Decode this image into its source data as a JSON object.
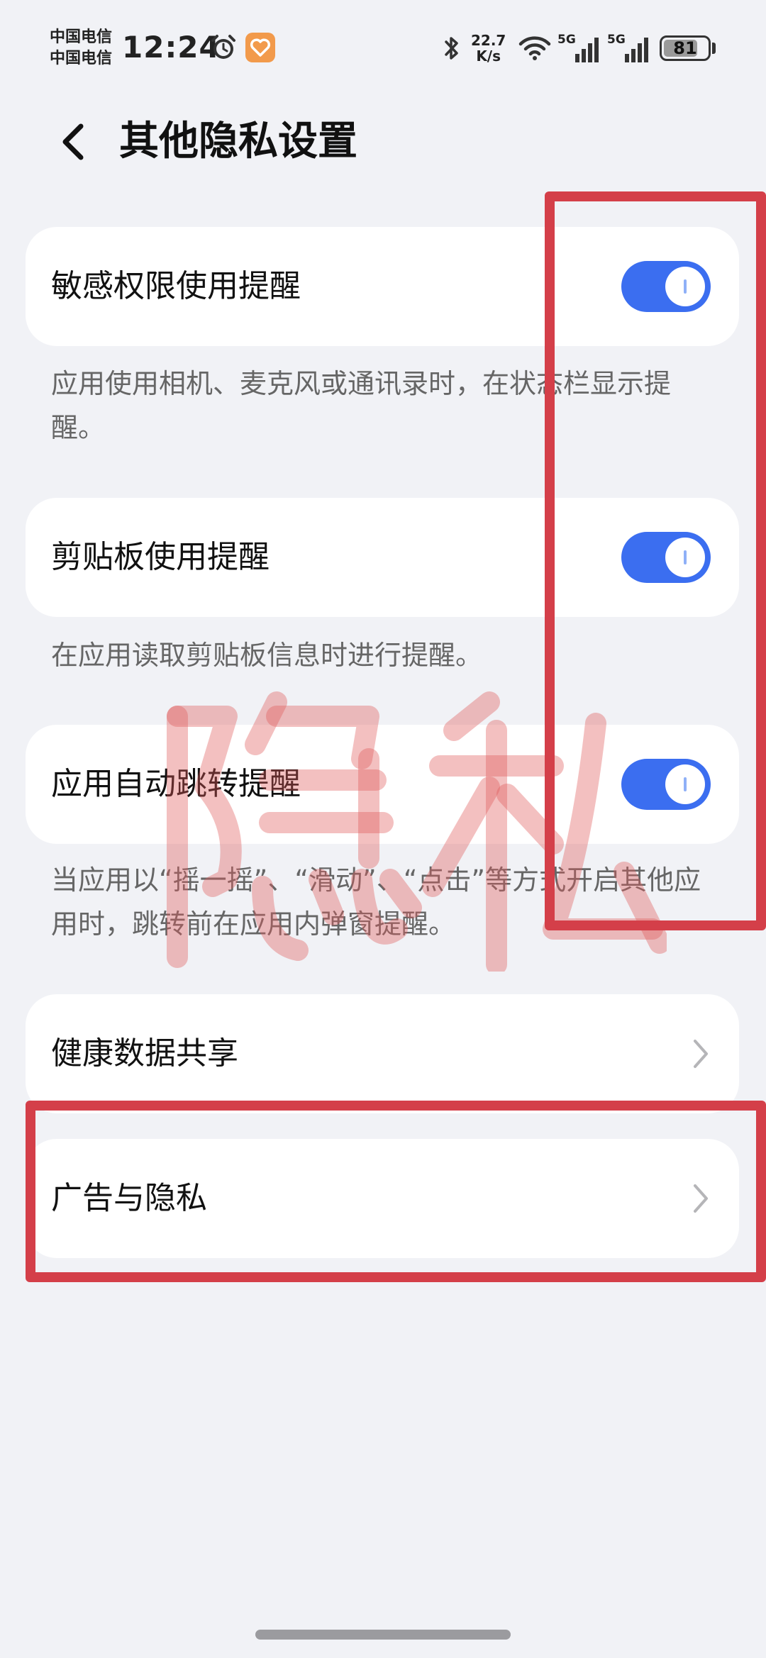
{
  "status_bar": {
    "carrier_1": "中国电信",
    "carrier_2": "中国电信",
    "time": "12:24",
    "net_speed_value": "22.7",
    "net_speed_unit": "K/s",
    "signal_1_tag": "5G",
    "signal_2_tag": "5G",
    "battery_level": "81",
    "battery_fill_percent": 81
  },
  "header": {
    "title": "其他隐私设置"
  },
  "settings": [
    {
      "label": "敏感权限使用提醒",
      "toggle_on": true,
      "description": "应用使用相机、麦克风或通讯录时，在状态栏显示提醒。"
    },
    {
      "label": "剪贴板使用提醒",
      "toggle_on": true,
      "description": "在应用读取剪贴板信息时进行提醒。"
    },
    {
      "label": "应用自动跳转提醒",
      "toggle_on": true,
      "description": "当应用以“摇一摇”、“滑动”、“点击”等方式开启其他应用时，跳转前在应用内弹窗提醒。"
    }
  ],
  "links": [
    {
      "label": "健康数据共享"
    },
    {
      "label": "广告与隐私"
    }
  ],
  "watermark": {
    "text": "隐私",
    "color": "#e05a5a"
  },
  "colors": {
    "accent": "#3b6ef0",
    "annotation": "#d43f49",
    "background": "#f1f2f6"
  }
}
